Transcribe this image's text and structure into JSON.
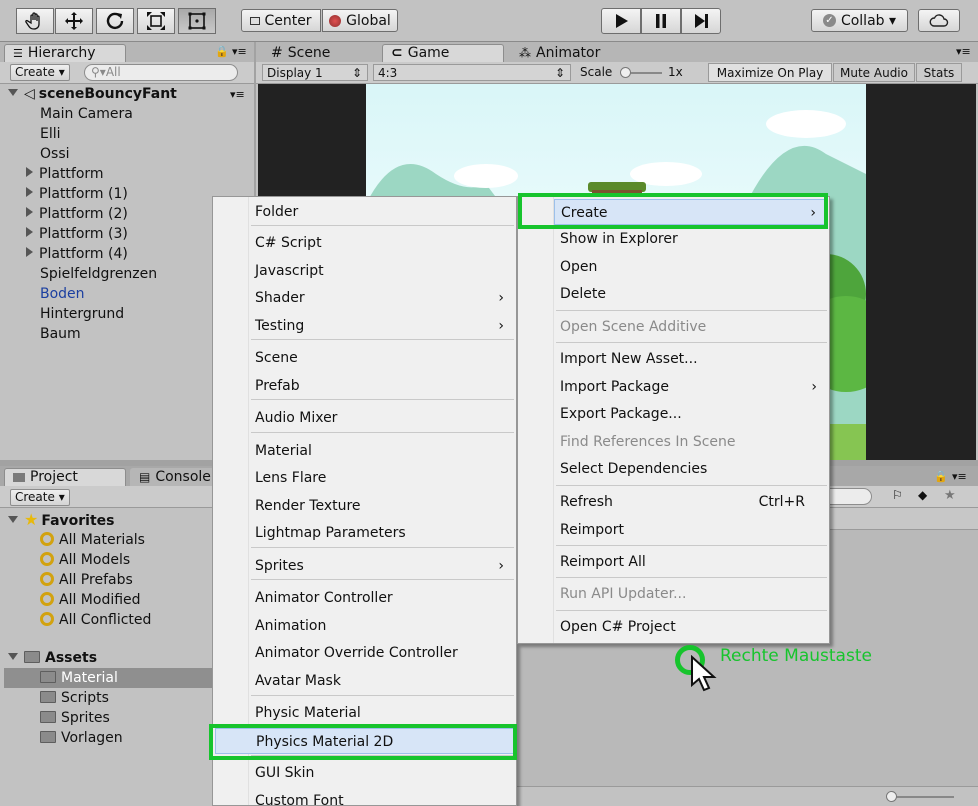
{
  "toolbar": {
    "tools": [
      "hand-icon",
      "move-icon",
      "rotate-icon",
      "scale-icon",
      "rect-icon"
    ],
    "center_label": "Center",
    "global_label": "Global",
    "collab_label": "Collab ▾"
  },
  "hierarchy": {
    "tab": "Hierarchy",
    "create": "Create ▾",
    "search_placeholder": "All",
    "scene_name": "sceneBouncyFant",
    "items": [
      {
        "label": "Main Camera",
        "expandable": false
      },
      {
        "label": "Elli",
        "expandable": false
      },
      {
        "label": "Ossi",
        "expandable": false
      },
      {
        "label": "Plattform",
        "expandable": true
      },
      {
        "label": "Plattform (1)",
        "expandable": true
      },
      {
        "label": "Plattform (2)",
        "expandable": true
      },
      {
        "label": "Plattform (3)",
        "expandable": true
      },
      {
        "label": "Plattform (4)",
        "expandable": true
      },
      {
        "label": "Spielfeldgrenzen",
        "expandable": false
      },
      {
        "label": "Boden",
        "expandable": false,
        "color": "#1b3fa0"
      },
      {
        "label": "Hintergrund",
        "expandable": false
      },
      {
        "label": "Baum",
        "expandable": false
      }
    ]
  },
  "scene_tabs": {
    "scene": "Scene",
    "game": "Game",
    "animator": "Animator"
  },
  "game_bar": {
    "display": "Display 1",
    "aspect": "4:3",
    "scale_label": "Scale",
    "scale_value": "1x",
    "maximize": "Maximize On Play",
    "mute": "Mute Audio",
    "stats": "Stats"
  },
  "project": {
    "tab": "Project",
    "console_tab": "Console",
    "create": "Create ▾",
    "favorites_label": "Favorites",
    "favorites": [
      "All Materials",
      "All Models",
      "All Prefabs",
      "All Modified",
      "All Conflicted"
    ],
    "assets_label": "Assets",
    "folders": [
      "Material",
      "Scripts",
      "Sprites",
      "Vorlagen"
    ]
  },
  "context_menu": {
    "items": [
      {
        "label": "Create",
        "submenu": true,
        "highlight": true
      },
      {
        "label": "Show in Explorer"
      },
      {
        "label": "Open"
      },
      {
        "label": "Delete"
      },
      {
        "label": "Open Scene Additive",
        "disabled": true
      },
      {
        "label": "Import New Asset..."
      },
      {
        "label": "Import Package",
        "submenu": true
      },
      {
        "label": "Export Package..."
      },
      {
        "label": "Find References In Scene",
        "disabled": true
      },
      {
        "label": "Select Dependencies"
      },
      {
        "label": "Refresh",
        "shortcut": "Ctrl+R"
      },
      {
        "label": "Reimport"
      },
      {
        "label": "Reimport All"
      },
      {
        "label": "Run API Updater...",
        "disabled": true
      },
      {
        "label": "Open C# Project"
      }
    ]
  },
  "create_menu": {
    "items": [
      {
        "label": "Folder"
      },
      {
        "label": "C# Script"
      },
      {
        "label": "Javascript"
      },
      {
        "label": "Shader",
        "submenu": true
      },
      {
        "label": "Testing",
        "submenu": true
      },
      {
        "label": "Scene"
      },
      {
        "label": "Prefab"
      },
      {
        "label": "Audio Mixer"
      },
      {
        "label": "Material"
      },
      {
        "label": "Lens Flare"
      },
      {
        "label": "Render Texture"
      },
      {
        "label": "Lightmap Parameters"
      },
      {
        "label": "Sprites",
        "submenu": true
      },
      {
        "label": "Animator Controller"
      },
      {
        "label": "Animation"
      },
      {
        "label": "Animator Override Controller"
      },
      {
        "label": "Avatar Mask"
      },
      {
        "label": "Physic Material"
      },
      {
        "label": "Physics Material 2D",
        "highlight": true
      },
      {
        "label": "GUI Skin"
      },
      {
        "label": "Custom Font"
      }
    ]
  },
  "annotation": {
    "label": "Rechte Maustaste",
    "color": "#17c42d"
  }
}
